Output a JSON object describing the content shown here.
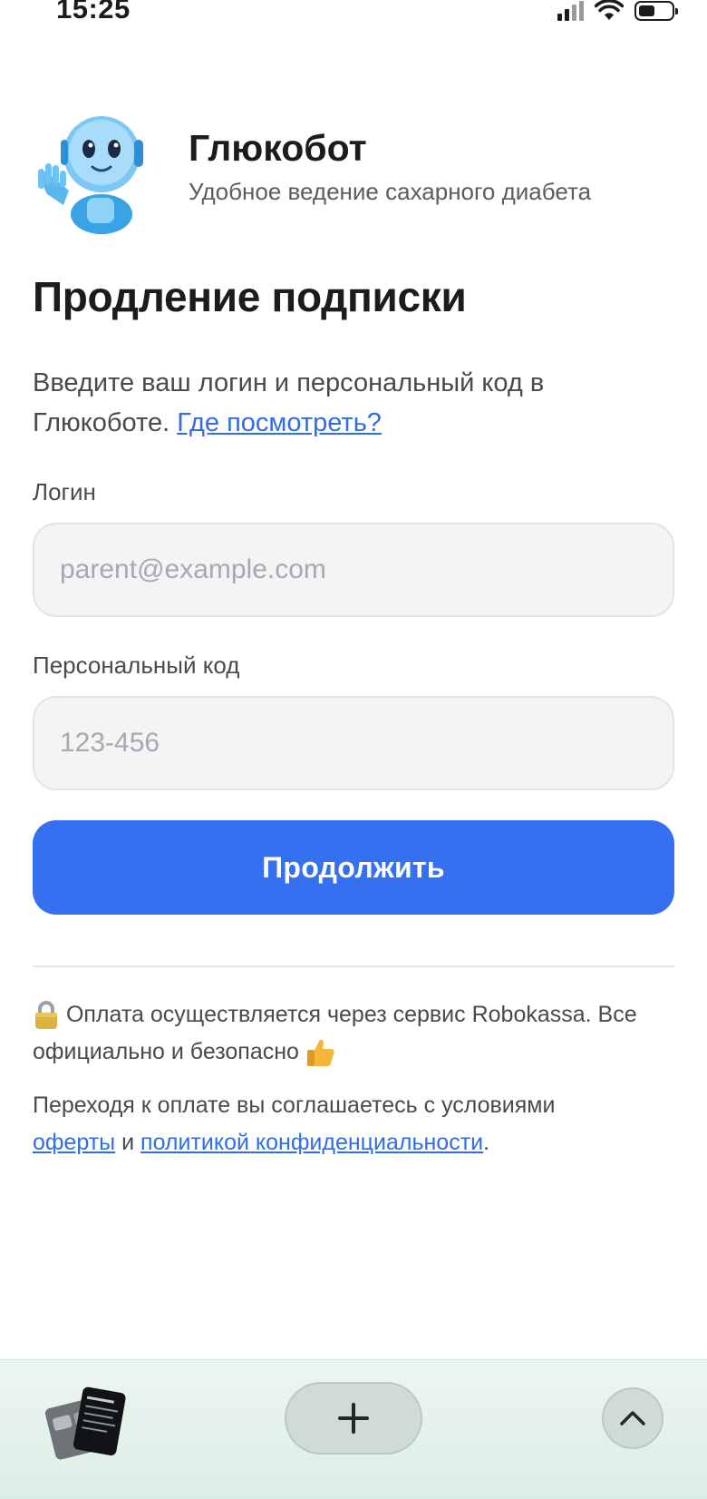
{
  "status_bar": {
    "time": "15:25"
  },
  "header": {
    "app_name": "Глюкобот",
    "tagline": "Удобное ведение сахарного диабета"
  },
  "page": {
    "title": "Продление подписки",
    "intro_text": "Введите ваш логин и персональный код в Глюкоботе.",
    "where_link": "Где посмотреть?"
  },
  "form": {
    "login_label": "Логин",
    "login_value": "",
    "login_placeholder": "parent@example.com",
    "code_label": "Персональный код",
    "code_value": "",
    "code_placeholder": "123-456",
    "submit_label": "Продолжить"
  },
  "footer": {
    "payment_text": "Оплата осуществляется через сервис Robokassa. Все официально и безопасно",
    "terms_prefix": "Переходя к оплате вы соглашаетесь с условиями",
    "offer_link": "оферты",
    "and_word": "и",
    "privacy_link": "политикой конфиденциальности",
    "period": "."
  },
  "colors": {
    "accent": "#3470f0",
    "link": "#2f6ee8",
    "toolbar_bg": "#dbeee6"
  },
  "icons": [
    "signal-icon",
    "wifi-icon",
    "battery-icon",
    "robot-mascot-icon",
    "lock-icon",
    "thumbs-up-icon",
    "plus-icon",
    "chevron-up-icon"
  ]
}
